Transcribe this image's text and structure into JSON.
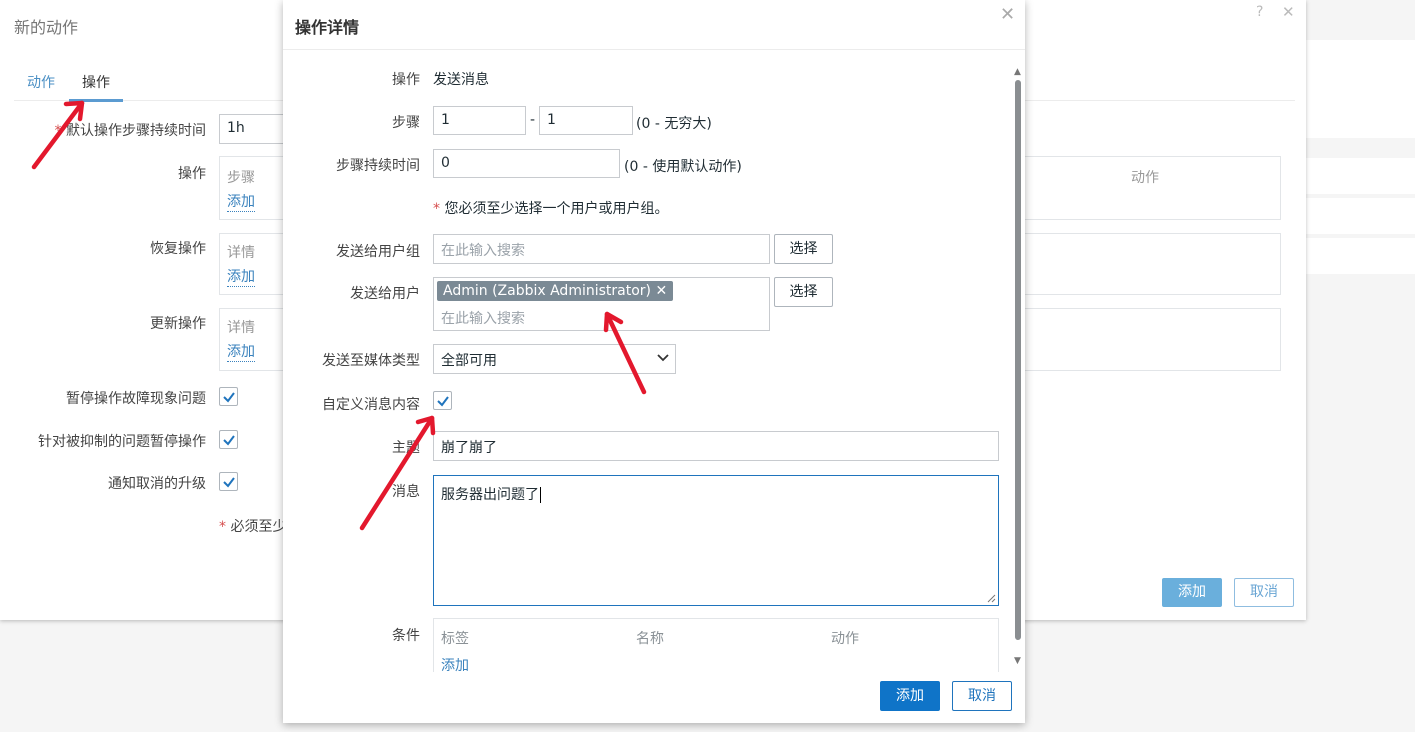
{
  "bg_dialog": {
    "title": "新的动作",
    "help": "?",
    "close": "✕",
    "tabs": [
      "动作",
      "操作"
    ],
    "fields": {
      "default_duration_label": "默认操作步骤持续时间",
      "default_duration_value": "1h",
      "operations_label": "操作",
      "operations_col1": "步骤",
      "operations_col_right": "动作",
      "operations_add": "添加",
      "recovery_label": "恢复操作",
      "recovery_col1": "详情",
      "recovery_add": "添加",
      "update_label": "更新操作",
      "update_col1": "详情",
      "update_add": "添加",
      "pause_symptoms_label": "暂停操作故障现象问题",
      "pause_suppressed_label": "针对被抑制的问题暂停操作",
      "notify_cancel_label": "通知取消的升级",
      "required_note": "必须至少"
    },
    "add_button": "添加",
    "cancel_button": "取消"
  },
  "dialog": {
    "title": "操作详情",
    "close": "✕",
    "operation_label": "操作",
    "operation_value": "发送消息",
    "steps_label": "步骤",
    "step_from": "1",
    "step_sep": "-",
    "step_to": "1",
    "step_hint": "(0 - 无穷大)",
    "step_duration_label": "步骤持续时间",
    "step_duration_value": "0",
    "step_duration_hint": "(0 - 使用默认动作)",
    "required_msg": "您必须至少选择一个用户或用户组。",
    "user_groups_label": "发送给用户组",
    "user_groups_placeholder": "在此输入搜索",
    "select_button": "选择",
    "users_label": "发送给用户",
    "user_chip": "Admin (Zabbix Administrator)",
    "chip_remove": "✕",
    "users_placeholder": "在此输入搜索",
    "select_button2": "选择",
    "media_label": "发送至媒体类型",
    "media_value": "全部可用",
    "custom_msg_label": "自定义消息内容",
    "custom_msg_checked": true,
    "subject_label": "主题",
    "subject_value": "崩了崩了",
    "message_label": "消息",
    "message_value": "服务器出问题了",
    "conditions_label": "条件",
    "cond_cols": [
      "标签",
      "名称",
      "动作"
    ],
    "cond_add": "添加",
    "add_button": "添加",
    "cancel_button": "取消"
  },
  "colors": {
    "accent": "#0f74c8",
    "annotation_arrow": "#e3182d"
  }
}
